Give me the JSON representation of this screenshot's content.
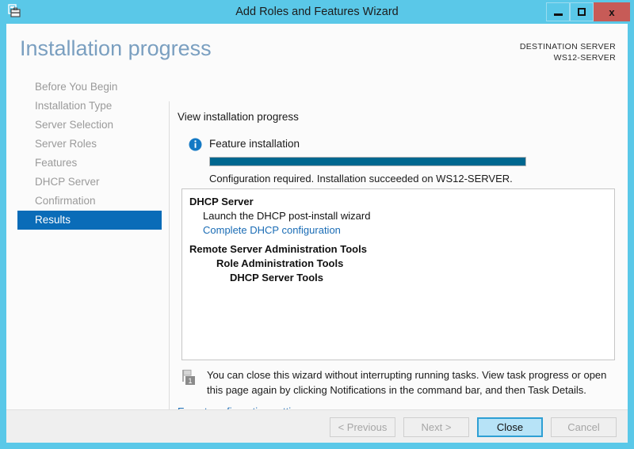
{
  "window": {
    "title": "Add Roles and Features Wizard",
    "app_icon": "server-toolbox-icon",
    "controls": {
      "minimize": "minimize-icon",
      "maximize": "maximize-icon",
      "close": "x"
    }
  },
  "header": {
    "page_title": "Installation progress",
    "destination_label": "DESTINATION SERVER",
    "destination_server": "WS12-SERVER"
  },
  "sidebar": {
    "items": [
      {
        "label": "Before You Begin",
        "active": false
      },
      {
        "label": "Installation Type",
        "active": false
      },
      {
        "label": "Server Selection",
        "active": false
      },
      {
        "label": "Server Roles",
        "active": false
      },
      {
        "label": "Features",
        "active": false
      },
      {
        "label": "DHCP Server",
        "active": false
      },
      {
        "label": "Confirmation",
        "active": false
      },
      {
        "label": "Results",
        "active": true
      }
    ]
  },
  "main": {
    "section_heading": "View installation progress",
    "info_icon": "info-icon",
    "feature_label": "Feature installation",
    "progress": {
      "percent": 100,
      "status": "Configuration required. Installation succeeded on WS12-SERVER."
    },
    "results": [
      {
        "text": "DHCP Server",
        "indent": 0,
        "bold": true,
        "link": false,
        "gap": false
      },
      {
        "text": "Launch the DHCP post-install wizard",
        "indent": 1,
        "bold": false,
        "link": false,
        "gap": false
      },
      {
        "text": "Complete DHCP configuration",
        "indent": 1,
        "bold": false,
        "link": true,
        "gap": false
      },
      {
        "text": "Remote Server Administration Tools",
        "indent": 0,
        "bold": true,
        "link": false,
        "gap": true
      },
      {
        "text": "Role Administration Tools",
        "indent": 2,
        "bold": true,
        "link": false,
        "gap": false
      },
      {
        "text": "DHCP Server Tools",
        "indent": 3,
        "bold": true,
        "link": false,
        "gap": false
      }
    ],
    "notice": {
      "flag_icon": "notification-flag-icon",
      "badge_count": "1",
      "text": "You can close this wizard without interrupting running tasks. View task progress or open this page again by clicking Notifications in the command bar, and then Task Details."
    },
    "export_link": "Export configuration settings"
  },
  "footer": {
    "buttons": [
      {
        "label": "< Previous",
        "state": "disabled"
      },
      {
        "label": "Next >",
        "state": "disabled"
      },
      {
        "label": "Close",
        "state": "default"
      },
      {
        "label": "Cancel",
        "state": "disabled"
      }
    ]
  },
  "colors": {
    "titlebar": "#5ac8e8",
    "close_button": "#c75b57",
    "accent_selected": "#0a6cb8",
    "progress_fill": "#00678f",
    "link": "#1a6cb5",
    "page_title": "#7a9fc0"
  }
}
